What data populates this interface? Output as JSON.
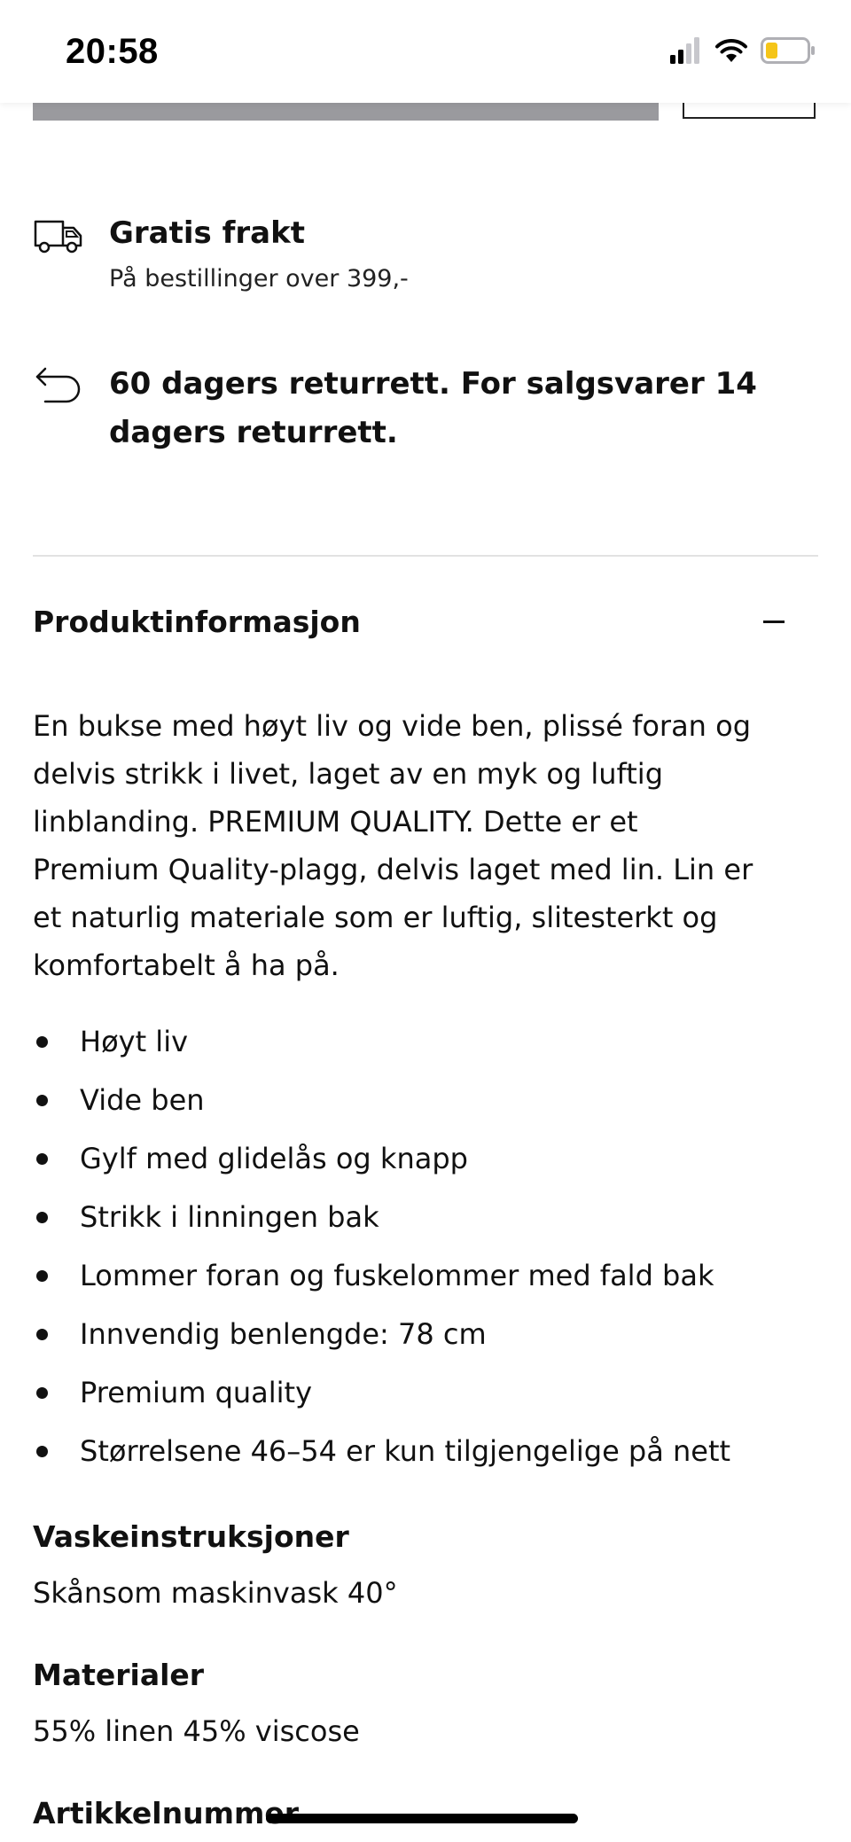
{
  "status_bar": {
    "time": "20:58",
    "icons": [
      "cellular-signal-icon",
      "wifi-icon",
      "battery-icon"
    ],
    "battery_color": "#f5c518"
  },
  "delivery": {
    "shipping": {
      "icon": "truck-icon",
      "title": "Gratis frakt",
      "subtitle": "På bestillinger over 399,-"
    },
    "returns": {
      "icon": "return-arrow-icon",
      "title_line1": "60 dagers returrett. For salgsvarer 14",
      "title_line2": "dagers returrett."
    }
  },
  "product_info": {
    "title": "Produktinformasjon",
    "toggle_icon": "minus-icon",
    "description_lines": [
      "En bukse med høyt liv og vide ben, plissé foran og",
      "delvis strikk i livet, laget av en myk og luftig",
      "linblanding. PREMIUM QUALITY. Dette er et",
      "Premium Quality-plagg, delvis laget med lin. Lin er",
      "et naturlig materiale som er luftig, slitesterkt og",
      "komfortabelt å ha på."
    ],
    "features": [
      "Høyt liv",
      "Vide ben",
      "Gylf med glidelås og knapp",
      "Strikk i linningen bak",
      "Lommer foran og fuskelommer med fald bak",
      "Innvendig benlengde: 78 cm",
      "Premium quality",
      "Størrelsene 46–54 er kun tilgjengelige på nett"
    ],
    "washing": {
      "label": "Vaskeinstruksjoner",
      "value": "Skånsom maskinvask 40°"
    },
    "materials": {
      "label": "Materialer",
      "value": "55% linen 45% viscose"
    },
    "article_number": {
      "label": "Artikkelnummer"
    }
  }
}
